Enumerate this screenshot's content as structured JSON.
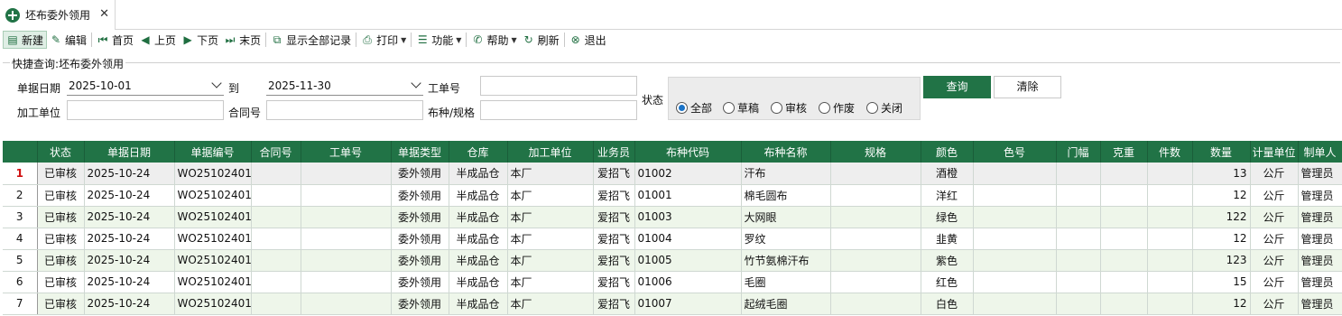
{
  "tab": {
    "title": "坯布委外领用",
    "close": "✕"
  },
  "toolbar": {
    "new": "新建",
    "edit": "编辑",
    "first": "首页",
    "prev": "上页",
    "next": "下页",
    "last": "末页",
    "show_all": "显示全部记录",
    "print": "打印",
    "functions": "功能",
    "help": "帮助",
    "refresh": "刷新",
    "exit": "退出"
  },
  "quick": {
    "legend": "快捷查询:坯布委外领用",
    "date_label": "单据日期",
    "date_from": "2025-10-01",
    "to_label": "到",
    "date_to": "2025-11-30",
    "work_order_label": "工单号",
    "work_order": "",
    "processor_label": "加工单位",
    "processor": "",
    "contract_label": "合同号",
    "contract": "",
    "fabric_label": "布种/规格",
    "fabric": "",
    "status_label": "状态",
    "status_options": [
      "全部",
      "草稿",
      "审核",
      "作废",
      "关闭"
    ],
    "status_selected": "全部",
    "query_button": "查询",
    "clear_button": "清除"
  },
  "table": {
    "columns": [
      "",
      "状态",
      "单据日期",
      "单据编号",
      "合同号",
      "工单号",
      "单据类型",
      "仓库",
      "加工单位",
      "业务员",
      "布种代码",
      "布种名称",
      "规格",
      "颜色",
      "色号",
      "门幅",
      "克重",
      "件数",
      "数量",
      "计量单位",
      "制单人"
    ],
    "rows": [
      [
        "1",
        "已审核",
        "2025-10-24",
        "WO25102401",
        "",
        "",
        "委外领用",
        "半成品仓",
        "本厂",
        "爱招飞",
        "01002",
        "汗布",
        "",
        "酒橙",
        "",
        "",
        "",
        "",
        "13",
        "公斤",
        "管理员"
      ],
      [
        "2",
        "已审核",
        "2025-10-24",
        "WO25102401",
        "",
        "",
        "委外领用",
        "半成品仓",
        "本厂",
        "爱招飞",
        "01001",
        "棉毛圆布",
        "",
        "洋红",
        "",
        "",
        "",
        "",
        "12",
        "公斤",
        "管理员"
      ],
      [
        "3",
        "已审核",
        "2025-10-24",
        "WO25102401",
        "",
        "",
        "委外领用",
        "半成品仓",
        "本厂",
        "爱招飞",
        "01003",
        "大网眼",
        "",
        "绿色",
        "",
        "",
        "",
        "",
        "122",
        "公斤",
        "管理员"
      ],
      [
        "4",
        "已审核",
        "2025-10-24",
        "WO25102401",
        "",
        "",
        "委外领用",
        "半成品仓",
        "本厂",
        "爱招飞",
        "01004",
        "罗纹",
        "",
        "韭黄",
        "",
        "",
        "",
        "",
        "12",
        "公斤",
        "管理员"
      ],
      [
        "5",
        "已审核",
        "2025-10-24",
        "WO25102401",
        "",
        "",
        "委外领用",
        "半成品仓",
        "本厂",
        "爱招飞",
        "01005",
        "竹节氨棉汗布",
        "",
        "紫色",
        "",
        "",
        "",
        "",
        "123",
        "公斤",
        "管理员"
      ],
      [
        "6",
        "已审核",
        "2025-10-24",
        "WO25102401",
        "",
        "",
        "委外领用",
        "半成品仓",
        "本厂",
        "爱招飞",
        "01006",
        "毛圈",
        "",
        "红色",
        "",
        "",
        "",
        "",
        "15",
        "公斤",
        "管理员"
      ],
      [
        "7",
        "已审核",
        "2025-10-24",
        "WO25102401",
        "",
        "",
        "委外领用",
        "半成品仓",
        "本厂",
        "爱招飞",
        "01007",
        "起绒毛圈",
        "",
        "白色",
        "",
        "",
        "",
        "",
        "12",
        "公斤",
        "管理员"
      ]
    ]
  },
  "colors": {
    "accent": "#217346",
    "row_alt": "#eef6ea"
  }
}
